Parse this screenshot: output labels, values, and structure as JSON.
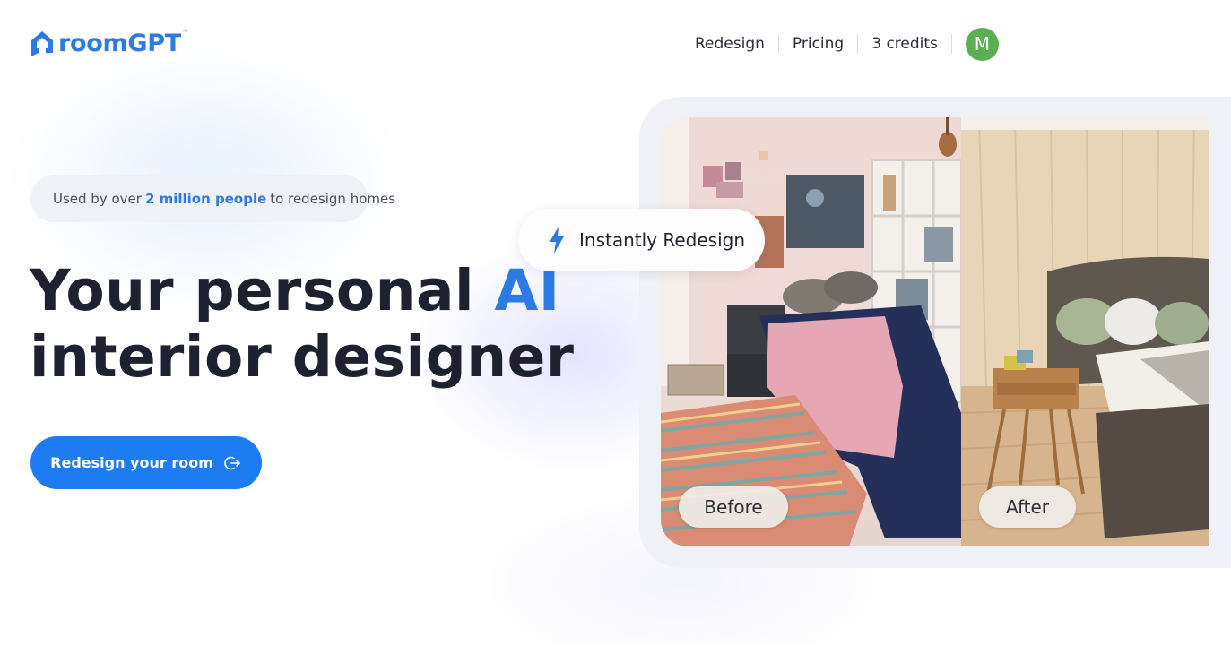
{
  "header": {
    "logo_text": "roomGPT",
    "logo_tm": "™",
    "nav": [
      {
        "label": "Redesign"
      },
      {
        "label": "Pricing"
      },
      {
        "label": "3 credits"
      }
    ],
    "avatar_initial": "M",
    "avatar_color": "#5cae53"
  },
  "hero": {
    "pill_pre": "Used by over",
    "pill_highlight": "2 million people",
    "pill_post": "to redesign homes",
    "headline_part1": "Your personal",
    "headline_accent": "AI",
    "headline_line2": "interior designer",
    "cta_label": "Redesign your room",
    "cta_icon": "exit-arrow-icon"
  },
  "showcase": {
    "badge_label": "Instantly Redesign",
    "badge_icon": "lightning-bolt-icon",
    "before_label": "Before",
    "after_label": "After"
  },
  "colors": {
    "brand_blue": "#2c7be5",
    "cta_blue": "#1d7cf2"
  }
}
